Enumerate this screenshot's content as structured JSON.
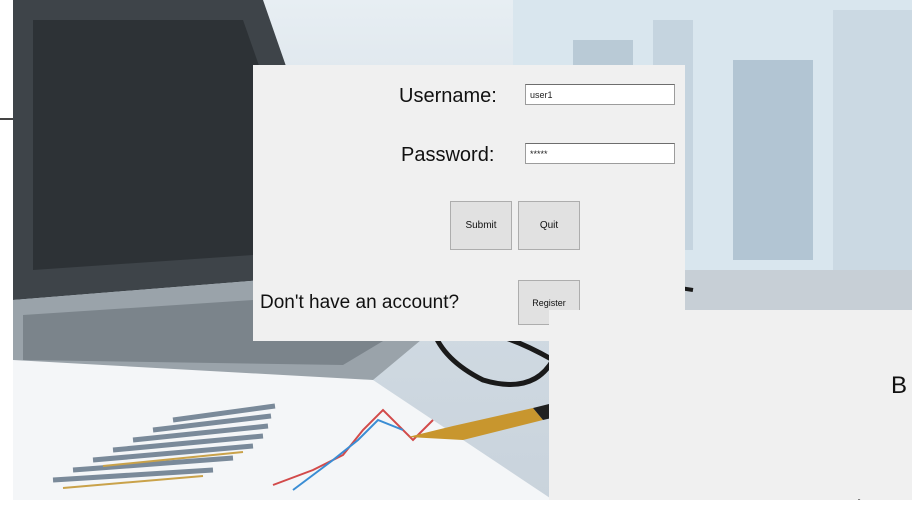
{
  "login": {
    "username_label": "Username:",
    "username_value": "user1",
    "password_label": "Password:",
    "password_value": "*****",
    "submit_label": "Submit",
    "quit_label": "Quit",
    "register_prompt": "Don't have an account?",
    "register_label": "Register"
  },
  "second_window": {
    "heading_partial": "B",
    "budget_partial": "Budge"
  }
}
